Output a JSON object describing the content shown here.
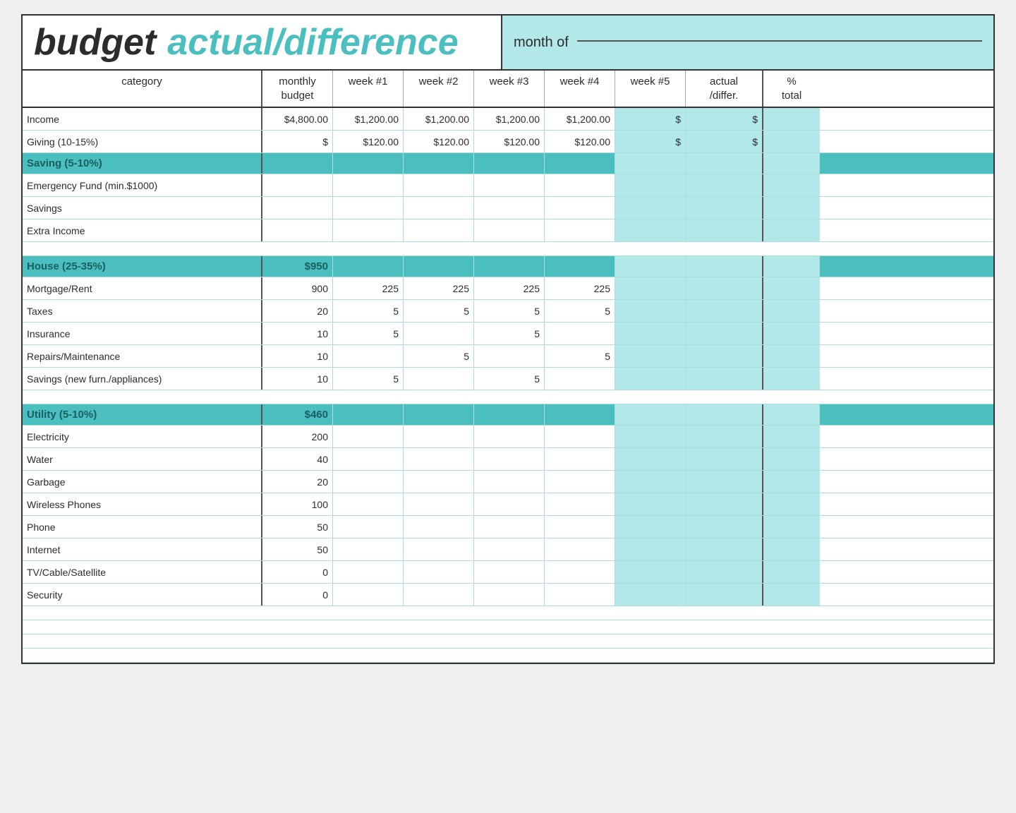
{
  "header": {
    "title_budget": "budget",
    "title_actual": "actual/difference",
    "month_of_label": "month of"
  },
  "columns": {
    "category": "category",
    "monthly_budget": "monthly\nbudget",
    "week1": "week #1",
    "week2": "week #2",
    "week3": "week #3",
    "week4": "week #4",
    "week5": "week #5",
    "actual_differ": "actual\n/differ.",
    "pct_total": "%\ntotal"
  },
  "sections": [
    {
      "type": "data-row",
      "category": "Income",
      "monthly_budget": "$4,800.00",
      "week1": "$1,200.00",
      "week2": "$1,200.00",
      "week3": "$1,200.00",
      "week4": "$1,200.00",
      "week5": "$",
      "actual": "$",
      "pct": ""
    },
    {
      "type": "data-row",
      "category": "Giving (10-15%)",
      "monthly_budget": "$",
      "week1": "$120.00",
      "week2": "$120.00",
      "week3": "$120.00",
      "week4": "$120.00",
      "week5": "$",
      "actual": "$",
      "pct": ""
    },
    {
      "type": "section-header",
      "category": "Saving (5-10%)",
      "monthly_budget": "",
      "week1": "",
      "week2": "",
      "week3": "",
      "week4": "",
      "week5": "",
      "actual": "",
      "pct": ""
    },
    {
      "type": "data-row",
      "category": "Emergency Fund (min.$1000)",
      "monthly_budget": "",
      "week1": "",
      "week2": "",
      "week3": "",
      "week4": "",
      "week5": "",
      "actual": "",
      "pct": ""
    },
    {
      "type": "data-row",
      "category": "Savings",
      "monthly_budget": "",
      "week1": "",
      "week2": "",
      "week3": "",
      "week4": "",
      "week5": "",
      "actual": "",
      "pct": ""
    },
    {
      "type": "data-row",
      "category": "Extra Income",
      "monthly_budget": "",
      "week1": "",
      "week2": "",
      "week3": "",
      "week4": "",
      "week5": "",
      "actual": "",
      "pct": ""
    },
    {
      "type": "blank-row"
    },
    {
      "type": "section-header",
      "category": "House (25-35%)",
      "monthly_budget": "$950",
      "week1": "",
      "week2": "",
      "week3": "",
      "week4": "",
      "week5": "",
      "actual": "",
      "pct": ""
    },
    {
      "type": "data-row",
      "category": "Mortgage/Rent",
      "monthly_budget": "900",
      "week1": "225",
      "week2": "225",
      "week3": "225",
      "week4": "225",
      "week5": "",
      "actual": "",
      "pct": ""
    },
    {
      "type": "data-row",
      "category": "Taxes",
      "monthly_budget": "20",
      "week1": "5",
      "week2": "5",
      "week3": "5",
      "week4": "5",
      "week5": "",
      "actual": "",
      "pct": ""
    },
    {
      "type": "data-row",
      "category": "Insurance",
      "monthly_budget": "10",
      "week1": "5",
      "week2": "",
      "week3": "5",
      "week4": "",
      "week5": "",
      "actual": "",
      "pct": ""
    },
    {
      "type": "data-row",
      "category": "Repairs/Maintenance",
      "monthly_budget": "10",
      "week1": "",
      "week2": "5",
      "week3": "",
      "week4": "5",
      "week5": "",
      "actual": "",
      "pct": ""
    },
    {
      "type": "data-row",
      "category": "Savings (new furn./appliances)",
      "monthly_budget": "10",
      "week1": "5",
      "week2": "",
      "week3": "5",
      "week4": "",
      "week5": "",
      "actual": "",
      "pct": ""
    },
    {
      "type": "blank-row"
    },
    {
      "type": "section-header",
      "category": "Utility (5-10%)",
      "monthly_budget": "$460",
      "week1": "",
      "week2": "",
      "week3": "",
      "week4": "",
      "week5": "",
      "actual": "",
      "pct": ""
    },
    {
      "type": "data-row",
      "category": "Electricity",
      "monthly_budget": "200",
      "week1": "",
      "week2": "",
      "week3": "",
      "week4": "",
      "week5": "",
      "actual": "",
      "pct": ""
    },
    {
      "type": "data-row",
      "category": "Water",
      "monthly_budget": "40",
      "week1": "",
      "week2": "",
      "week3": "",
      "week4": "",
      "week5": "",
      "actual": "",
      "pct": ""
    },
    {
      "type": "data-row",
      "category": "Garbage",
      "monthly_budget": "20",
      "week1": "",
      "week2": "",
      "week3": "",
      "week4": "",
      "week5": "",
      "actual": "",
      "pct": ""
    },
    {
      "type": "data-row",
      "category": "Wireless Phones",
      "monthly_budget": "100",
      "week1": "",
      "week2": "",
      "week3": "",
      "week4": "",
      "week5": "",
      "actual": "",
      "pct": ""
    },
    {
      "type": "data-row",
      "category": "Phone",
      "monthly_budget": "50",
      "week1": "",
      "week2": "",
      "week3": "",
      "week4": "",
      "week5": "",
      "actual": "",
      "pct": ""
    },
    {
      "type": "data-row",
      "category": "Internet",
      "monthly_budget": "50",
      "week1": "",
      "week2": "",
      "week3": "",
      "week4": "",
      "week5": "",
      "actual": "",
      "pct": ""
    },
    {
      "type": "data-row",
      "category": "TV/Cable/Satellite",
      "monthly_budget": "0",
      "week1": "",
      "week2": "",
      "week3": "",
      "week4": "",
      "week5": "",
      "actual": "",
      "pct": ""
    },
    {
      "type": "data-row",
      "category": "Security",
      "monthly_budget": "0",
      "week1": "",
      "week2": "",
      "week3": "",
      "week4": "",
      "week5": "",
      "actual": "",
      "pct": ""
    },
    {
      "type": "blank-row"
    },
    {
      "type": "blank-row"
    },
    {
      "type": "blank-row"
    },
    {
      "type": "blank-row"
    }
  ]
}
